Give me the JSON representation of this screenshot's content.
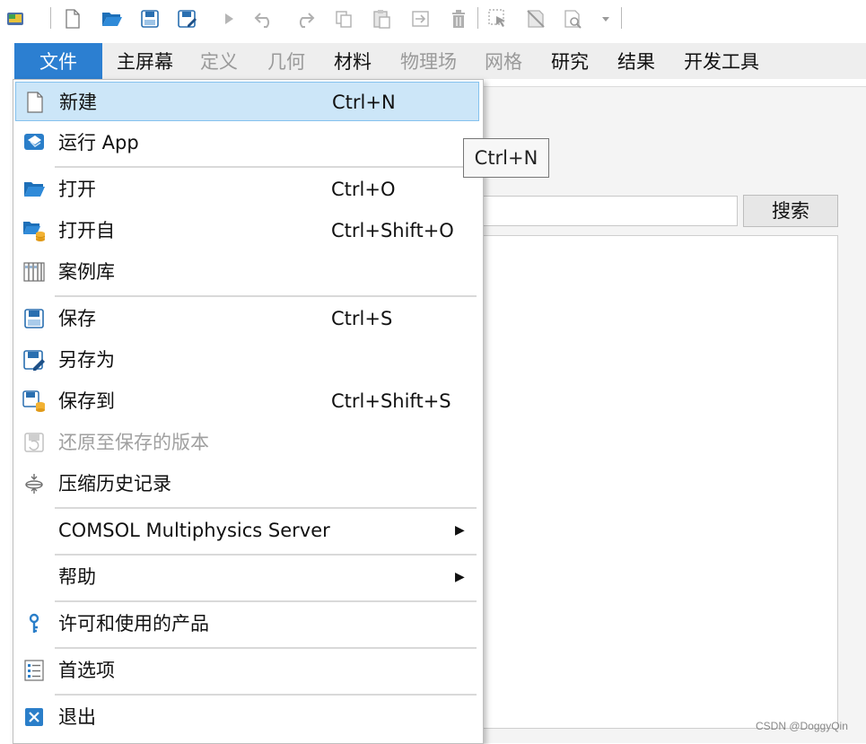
{
  "quick_access_toolbar": {
    "icons": [
      "app-icon",
      "new-icon",
      "open-icon",
      "save-icon",
      "save-as-icon",
      "run-icon",
      "undo-icon",
      "redo-icon",
      "copy-icon",
      "paste-icon",
      "duplicate-icon",
      "delete-icon",
      "select-icon",
      "disable-icon",
      "find-icon",
      "customize-dropdown-icon"
    ]
  },
  "ribbon": {
    "tabs": [
      {
        "label": "文件",
        "state": "active"
      },
      {
        "label": "主屏幕",
        "state": "enabled"
      },
      {
        "label": "定义",
        "state": "disabled"
      },
      {
        "label": "几何",
        "state": "disabled"
      },
      {
        "label": "材料",
        "state": "enabled"
      },
      {
        "label": "物理场",
        "state": "disabled"
      },
      {
        "label": "网格",
        "state": "disabled"
      },
      {
        "label": "研究",
        "state": "enabled"
      },
      {
        "label": "结果",
        "state": "enabled"
      },
      {
        "label": "开发工具",
        "state": "enabled"
      }
    ]
  },
  "search": {
    "button_label": "搜索",
    "value": ""
  },
  "tooltip": {
    "text": "Ctrl+N"
  },
  "file_menu": {
    "items": [
      {
        "label": "新建",
        "shortcut": "Ctrl+N",
        "icon": "new-document-icon",
        "state": "highlighted"
      },
      {
        "label": "运行 App",
        "shortcut": "",
        "icon": "run-app-icon",
        "state": "enabled"
      },
      {
        "label": "打开",
        "shortcut": "Ctrl+O",
        "icon": "open-folder-icon",
        "state": "enabled"
      },
      {
        "label": "打开自",
        "shortcut": "Ctrl+Shift+O",
        "icon": "open-from-database-icon",
        "state": "enabled"
      },
      {
        "label": "案例库",
        "shortcut": "",
        "icon": "application-library-icon",
        "state": "enabled"
      },
      {
        "label": "保存",
        "shortcut": "Ctrl+S",
        "icon": "save-icon",
        "state": "enabled"
      },
      {
        "label": "另存为",
        "shortcut": "",
        "icon": "save-as-icon",
        "state": "enabled"
      },
      {
        "label": "保存到",
        "shortcut": "Ctrl+Shift+S",
        "icon": "save-to-database-icon",
        "state": "enabled"
      },
      {
        "label": "还原至保存的版本",
        "shortcut": "",
        "icon": "revert-icon",
        "state": "disabled"
      },
      {
        "label": "压缩历史记录",
        "shortcut": "",
        "icon": "compact-history-icon",
        "state": "enabled"
      },
      {
        "label": "COMSOL Multiphysics Server",
        "shortcut": "",
        "icon": "",
        "state": "submenu"
      },
      {
        "label": "帮助",
        "shortcut": "",
        "icon": "",
        "state": "submenu"
      },
      {
        "label": "许可和使用的产品",
        "shortcut": "",
        "icon": "license-key-icon",
        "state": "enabled"
      },
      {
        "label": "首选项",
        "shortcut": "",
        "icon": "preferences-icon",
        "state": "enabled"
      },
      {
        "label": "退出",
        "shortcut": "",
        "icon": "exit-icon",
        "state": "enabled"
      }
    ]
  },
  "watermark": "CSDN @DoggyQin",
  "colors": {
    "accent": "#2c7fd1",
    "highlight": "#cce6f8",
    "highlight_border": "#85c2ee",
    "icon_blue": "#2a7ec9",
    "disabled": "#a0a0a0"
  }
}
